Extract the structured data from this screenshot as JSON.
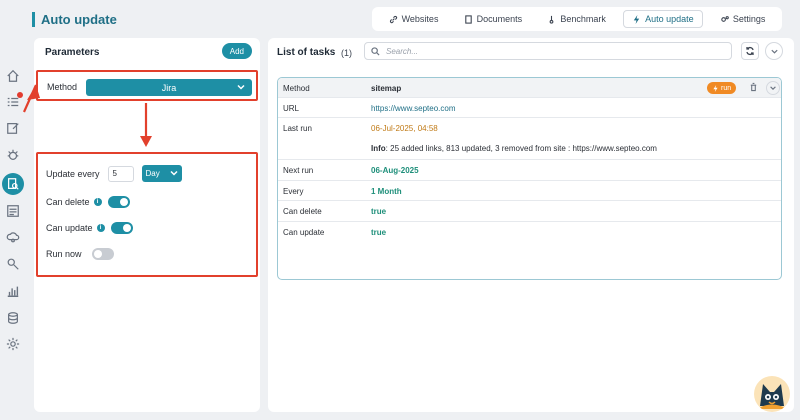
{
  "header": {
    "title": "Auto update",
    "tabs": [
      {
        "label": "Websites",
        "icon": "link-icon"
      },
      {
        "label": "Documents",
        "icon": "document-icon"
      },
      {
        "label": "Benchmark",
        "icon": "thermometer-icon"
      },
      {
        "label": "Auto update",
        "icon": "lightning-icon",
        "active": true
      },
      {
        "label": "Settings",
        "icon": "gears-icon"
      }
    ]
  },
  "sidebar": {
    "icons": [
      "home-icon",
      "list-icon",
      "edit-icon",
      "bug-icon",
      "search-document-icon",
      "checklist-icon",
      "cloud-gear-icon",
      "search-users-icon",
      "bar-chart-icon",
      "database-icon",
      "gear-icon"
    ]
  },
  "parameters": {
    "title": "Parameters",
    "add_label": "Add",
    "method_label": "Method",
    "method_value": "Jira",
    "update_every_label": "Update every",
    "update_every_value": "5",
    "unit_value": "Day",
    "can_delete_label": "Can delete",
    "can_update_label": "Can update",
    "run_now_label": "Run now",
    "can_delete_on": true,
    "can_update_on": true,
    "run_now_on": false
  },
  "tasks": {
    "title": "List of tasks",
    "count": "(1)",
    "search_placeholder": "Search...",
    "run_label": "run",
    "rows": [
      {
        "key": "Method",
        "value": "sitemap"
      },
      {
        "key": "URL",
        "value": "https://www.septeo.com"
      },
      {
        "key": "Last run",
        "value": "06-Jul-2025, 04:58"
      },
      {
        "key": "",
        "info_label": "Info",
        "value": ": 25 added links, 813 updated, 3 removed from site : https://www.septeo.com"
      },
      {
        "key": "Next run",
        "value": "06-Aug-2025"
      },
      {
        "key": "Every",
        "value": "1 Month"
      },
      {
        "key": "Can delete",
        "value": "true"
      },
      {
        "key": "Can update",
        "value": "true"
      }
    ]
  },
  "colors": {
    "accent": "#1e8fa5",
    "annotation": "#e2402c",
    "run_badge": "#f08a24"
  }
}
